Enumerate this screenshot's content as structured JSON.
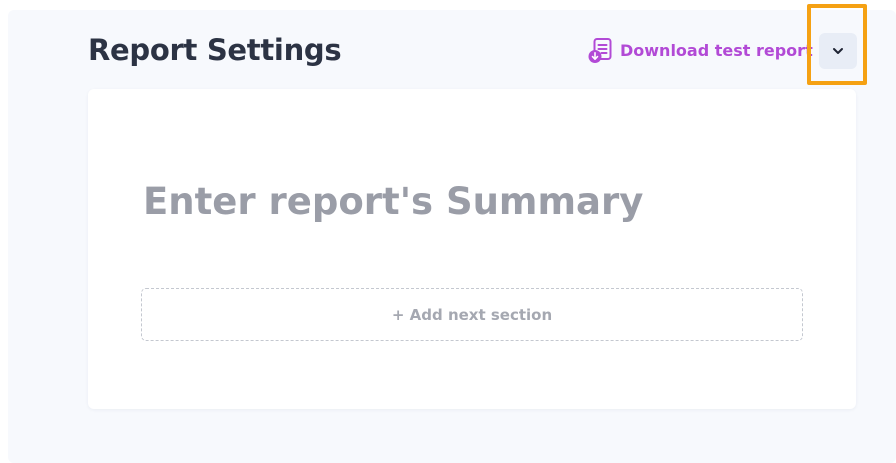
{
  "header": {
    "title": "Report Settings",
    "download_label": "Download test report",
    "download_icon": "document-download-icon",
    "menu_icon": "chevron-down-icon"
  },
  "summary": {
    "placeholder": "Enter report's Summary",
    "value": ""
  },
  "sections": {
    "add_label": "+ Add next section"
  },
  "colors": {
    "accent": "#b24ad6",
    "highlight": "#f5a113",
    "title": "#2c3344",
    "placeholder": "#9a9da7",
    "background": "#f7f9fd"
  }
}
